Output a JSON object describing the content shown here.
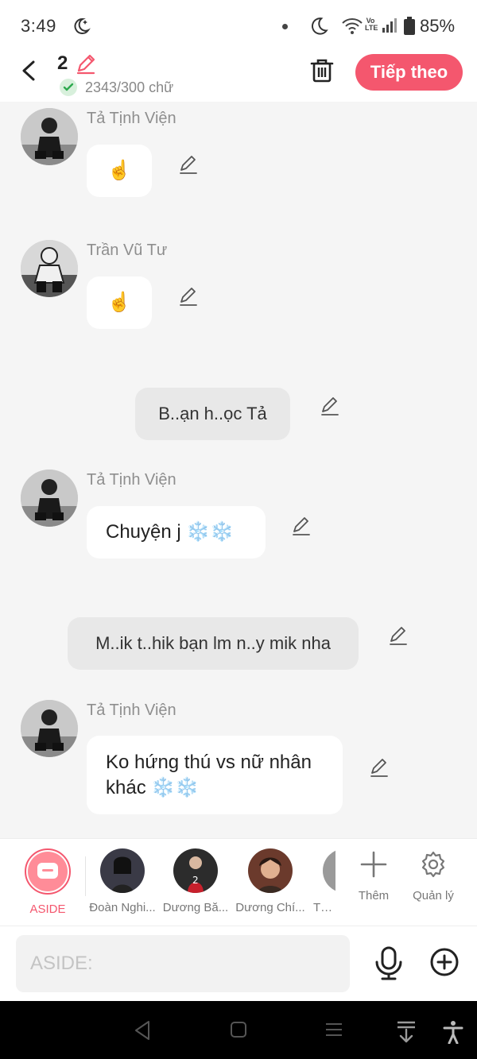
{
  "status_bar": {
    "time": "3:49",
    "battery": "85%",
    "network_badge": "Vo LTE"
  },
  "header": {
    "chapter_number": "2",
    "word_count": "2343/300 chữ",
    "next_label": "Tiếp theo"
  },
  "messages": [
    {
      "type": "character",
      "sender": "Tả Tịnh Viện",
      "text": "☝️"
    },
    {
      "type": "character",
      "sender": "Trần Vũ Tư",
      "text": "☝️"
    },
    {
      "type": "narration",
      "text": "B..ạn h..ọc Tả"
    },
    {
      "type": "character",
      "sender": "Tả Tịnh Viện",
      "text": "Chuyện j ❄️❄️"
    },
    {
      "type": "narration",
      "text": "M..ik t..hik bạn lm n..y mik nha"
    },
    {
      "type": "character",
      "sender": "Tả Tịnh Viện",
      "text": "Ko hứng thú vs nữ nhân khác ❄️❄️"
    }
  ],
  "character_bar": {
    "aside_label": "ASIDE",
    "characters": [
      {
        "name": "Đoàn Nghi..."
      },
      {
        "name": "Dương Bă..."
      },
      {
        "name": "Dương Chí..."
      },
      {
        "name": "Tả T"
      }
    ],
    "add_label": "Thêm",
    "manage_label": "Quản lý"
  },
  "input": {
    "placeholder": "ASIDE:"
  },
  "colors": {
    "accent": "#f4576e",
    "background": "#f5f5f5",
    "narration_bubble": "#e8e8e8"
  }
}
